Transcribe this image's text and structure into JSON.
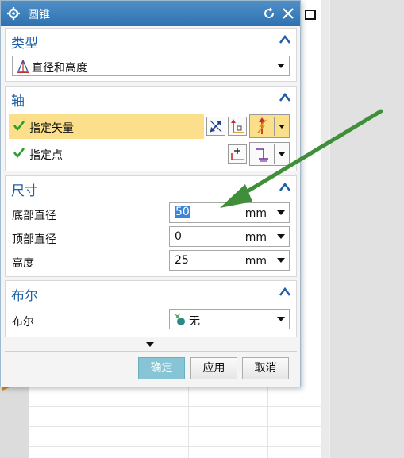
{
  "dialog": {
    "title": "圆锥",
    "icons": {
      "settings": "gear-icon",
      "reset": "reset-icon",
      "close": "close-icon"
    }
  },
  "sections": {
    "type": {
      "title": "类型",
      "selected": "直径和高度"
    },
    "axis": {
      "title": "轴",
      "vector_label": "指定矢量",
      "point_label": "指定点"
    },
    "dimensions": {
      "title": "尺寸",
      "fields": [
        {
          "label": "底部直径",
          "value": "50",
          "unit": "mm"
        },
        {
          "label": "顶部直径",
          "value": "0",
          "unit": "mm"
        },
        {
          "label": "高度",
          "value": "25",
          "unit": "mm"
        }
      ]
    },
    "boolean": {
      "title": "布尔",
      "label": "布尔",
      "selected": "无"
    }
  },
  "buttons": {
    "ok": "确定",
    "apply": "应用",
    "cancel": "取消"
  },
  "colors": {
    "title_bar": "#2f72b0",
    "section_title": "#1f5fa6",
    "highlight": "#fbdf8a",
    "check": "#2e9d2e",
    "callout_arrow": "#3f8f3a",
    "ok_button": "#86c4d6"
  }
}
